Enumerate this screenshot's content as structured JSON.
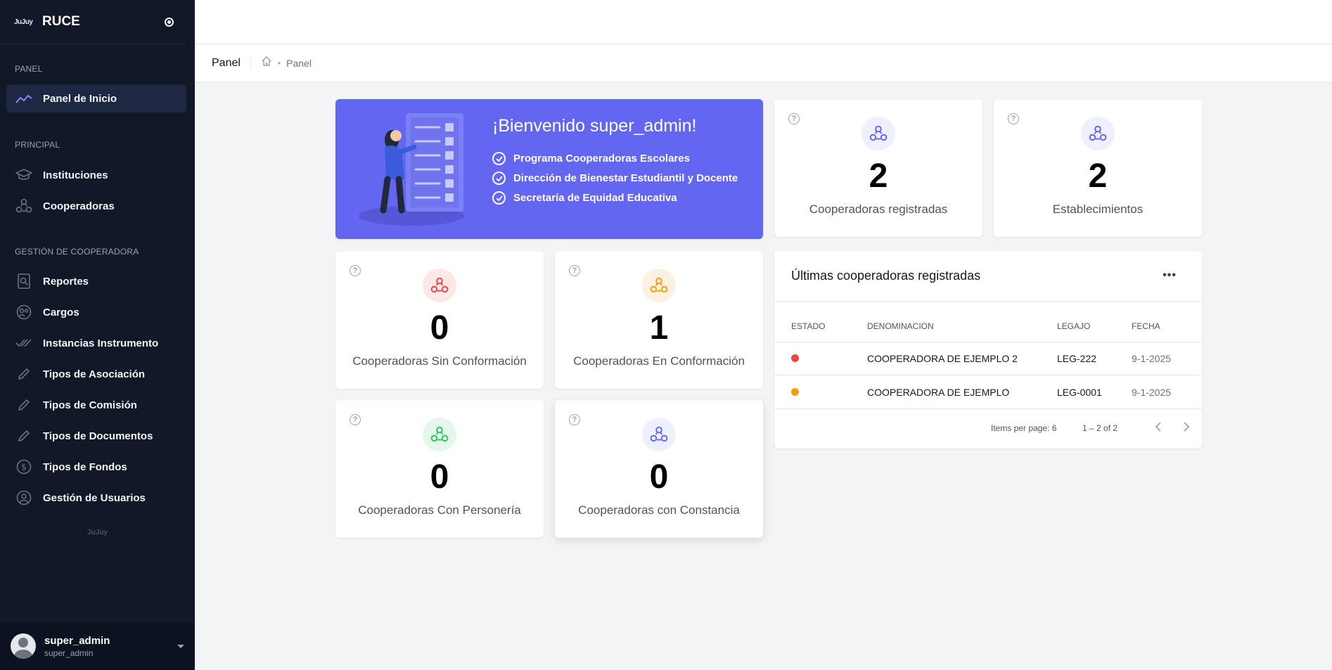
{
  "sidebar": {
    "logo_text": "JuJuy",
    "title": "RUCE",
    "sections": {
      "panel": "PANEL",
      "principal": "PRINCIPAL",
      "gestion": "GESTIÓN DE COOPERADORA"
    },
    "items": [
      {
        "label": "Panel de Inicio",
        "icon": "chart-line-icon",
        "active": true
      },
      {
        "label": "Instituciones",
        "icon": "graduation-cap-icon"
      },
      {
        "label": "Cooperadoras",
        "icon": "cooperadoras-icon"
      },
      {
        "label": "Reportes",
        "icon": "report-icon"
      },
      {
        "label": "Cargos",
        "icon": "cargos-icon"
      },
      {
        "label": "Instancias Instrumento",
        "icon": "double-check-icon"
      },
      {
        "label": "Tipos de Asociación",
        "icon": "pencil-icon"
      },
      {
        "label": "Tipos de Comisión",
        "icon": "pencil-icon"
      },
      {
        "label": "Tipos de Documentos",
        "icon": "pencil-icon"
      },
      {
        "label": "Tipos de Fondos",
        "icon": "dollar-icon"
      },
      {
        "label": "Gestión de Usuarios",
        "icon": "user-circle-icon"
      }
    ],
    "footer_logo": "JuJuy",
    "user": {
      "name": "super_admin",
      "sub": "super_admin"
    }
  },
  "breadcrumb": {
    "title": "Panel",
    "path": "Panel"
  },
  "welcome": {
    "title": "¡Bienvenido super_admin!",
    "items": [
      "Programa Cooperadoras Escolares",
      "Dirección de Bienestar Estudiantil y Docente",
      "Secretaría de Equidad Educativa"
    ]
  },
  "stats": {
    "registradas": {
      "value": "2",
      "label": "Cooperadoras registradas",
      "color": "#6366f1"
    },
    "establecimientos": {
      "value": "2",
      "label": "Establecimientos",
      "color": "#6366f1"
    },
    "sin_conformacion": {
      "value": "0",
      "label": "Cooperadoras Sin Conformación",
      "color": "#ef4444"
    },
    "en_conformacion": {
      "value": "1",
      "label": "Cooperadoras En Conformación",
      "color": "#f59e0b"
    },
    "con_personeria": {
      "value": "0",
      "label": "Cooperadoras Con Personería",
      "color": "#22c55e"
    },
    "con_constancia": {
      "value": "0",
      "label": "Cooperadoras con Constancia",
      "color": "#6366f1"
    }
  },
  "table": {
    "title": "Últimas cooperadoras registradas",
    "headers": {
      "estado": "ESTADO",
      "denominacion": "DENOMINACION",
      "legajo": "LEGAJO",
      "fecha": "FECHA"
    },
    "rows": [
      {
        "status_color": "#ef4444",
        "denominacion": "COOPERADORA DE EJEMPLO 2",
        "legajo": "LEG-222",
        "fecha": "9-1-2025"
      },
      {
        "status_color": "#f59e0b",
        "denominacion": "COOPERADORA DE EJEMPLO",
        "legajo": "LEG-0001",
        "fecha": "9-1-2025"
      }
    ],
    "items_per_page": "Items per page: 6",
    "range": "1 – 2 of 2"
  }
}
